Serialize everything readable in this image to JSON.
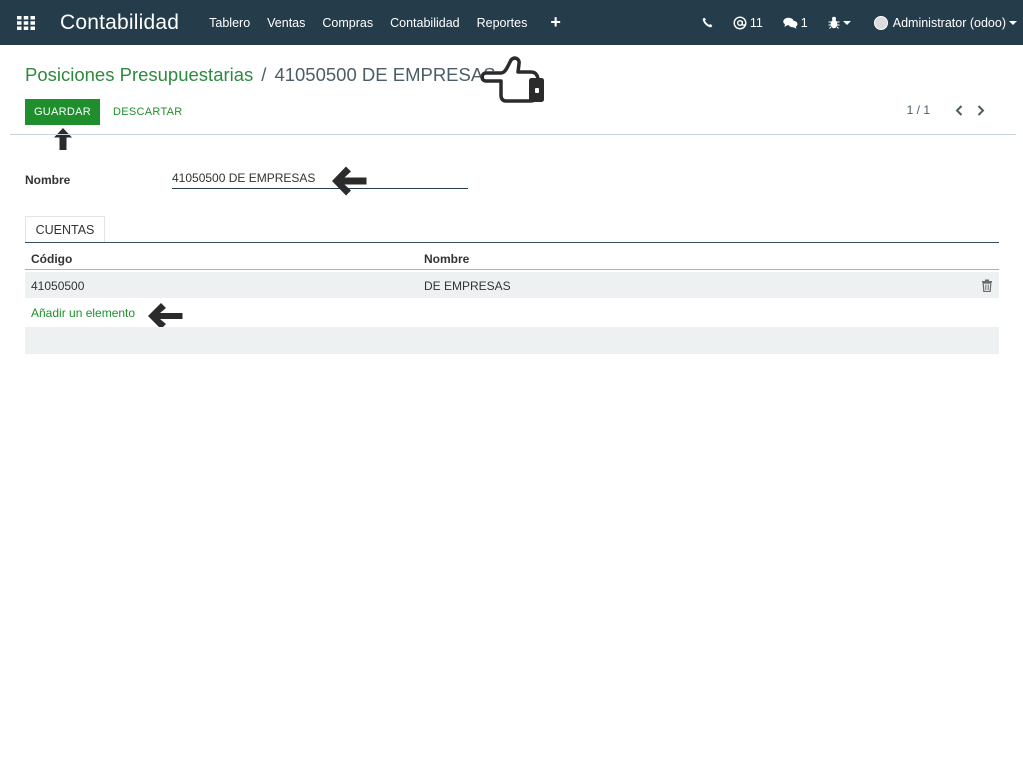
{
  "navbar": {
    "apps_icon": "grid-icon",
    "brand": "Contabilidad",
    "menu": [
      "Tablero",
      "Ventas",
      "Compras",
      "Contabilidad",
      "Reportes"
    ],
    "plus": "+",
    "activity_count": "11",
    "messages_count": "1",
    "user": "Administrator (odoo)"
  },
  "breadcrumb": {
    "parent": "Posiciones Presupuestarias",
    "separator": "/",
    "current": "41050500 DE EMPRESAS"
  },
  "actions": {
    "save": "GUARDAR",
    "discard": "DESCARTAR"
  },
  "pager": {
    "value": "1 / 1"
  },
  "form": {
    "name_label": "Nombre",
    "name_value": "41050500 DE EMPRESAS"
  },
  "tab": {
    "label": "CUENTAS"
  },
  "table": {
    "headers": [
      "Código",
      "Nombre"
    ],
    "rows": [
      {
        "code": "41050500",
        "name": "DE EMPRESAS"
      }
    ],
    "add_line": "Añadir un elemento"
  },
  "colors": {
    "navbar": "#253C4A",
    "primary": "#1f8f2e",
    "row_bg": "#eef1f2"
  }
}
